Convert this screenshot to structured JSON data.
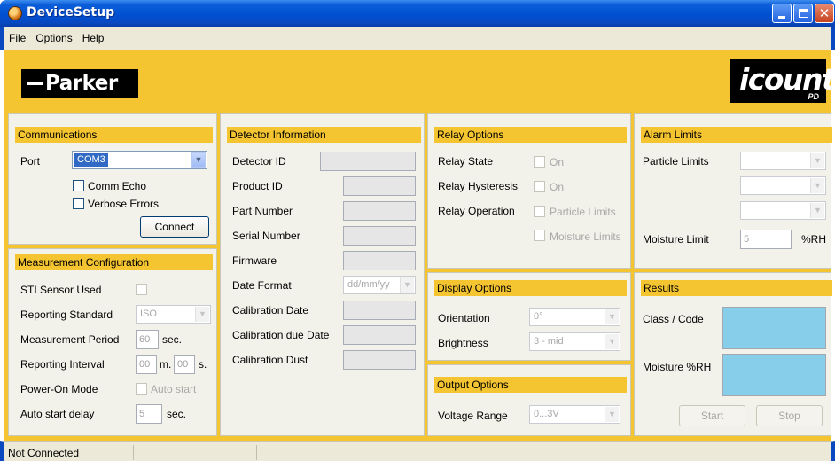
{
  "window": {
    "title": "DeviceSetup"
  },
  "menu": [
    "File",
    "Options",
    "Help"
  ],
  "banner": {
    "left_logo": "Parker",
    "right_logo": "icount",
    "right_logo_sub": "PD"
  },
  "communications": {
    "header": "Communications",
    "port_label": "Port",
    "port_value": "COM3",
    "comm_echo_label": "Comm Echo",
    "comm_echo_checked": false,
    "verbose_errors_label": "Verbose Errors",
    "verbose_errors_checked": false,
    "connect_label": "Connect"
  },
  "measurement": {
    "header": "Measurement Configuration",
    "sti_sensor_label": "STI Sensor Used",
    "sti_sensor_checked": false,
    "reporting_standard_label": "Reporting Standard",
    "reporting_standard_value": "ISO",
    "measurement_period_label": "Measurement Period",
    "measurement_period_value": "60",
    "measurement_period_unit": "sec.",
    "reporting_interval_label": "Reporting Interval",
    "reporting_interval_min": "00",
    "reporting_interval_min_unit": "m.",
    "reporting_interval_sec": "00",
    "reporting_interval_sec_unit": "s.",
    "power_on_mode_label": "Power-On Mode",
    "auto_start_label": "Auto start",
    "auto_start_checked": false,
    "auto_start_delay_label": "Auto start delay",
    "auto_start_delay_value": "5",
    "auto_start_delay_unit": "sec."
  },
  "detector": {
    "header": "Detector Information",
    "detector_id_label": "Detector ID",
    "product_id_label": "Product ID",
    "part_number_label": "Part Number",
    "serial_number_label": "Serial Number",
    "firmware_label": "Firmware",
    "date_format_label": "Date Format",
    "date_format_value": "dd/mm/yy",
    "calibration_date_label": "Calibration Date",
    "calibration_due_date_label": "Calibration due Date",
    "calibration_dust_label": "Calibration Dust"
  },
  "relay": {
    "header": "Relay Options",
    "relay_state_label": "Relay State",
    "relay_state_option": "On",
    "relay_hysteresis_label": "Relay Hysteresis",
    "relay_hysteresis_option": "On",
    "relay_operation_label": "Relay Operation",
    "particle_limits_option": "Particle Limits",
    "moisture_limits_option": "Moisture Limits"
  },
  "display": {
    "header": "Display Options",
    "orientation_label": "Orientation",
    "orientation_value": "0°",
    "brightness_label": "Brightness",
    "brightness_value": "3 - mid"
  },
  "output": {
    "header": "Output Options",
    "voltage_range_label": "Voltage Range",
    "voltage_range_value": "0...3V"
  },
  "alarm": {
    "header": "Alarm Limits",
    "particle_limits_label": "Particle Limits",
    "moisture_limit_label": "Moisture Limit",
    "moisture_limit_value": "5",
    "moisture_limit_unit": "%RH"
  },
  "results": {
    "header": "Results",
    "class_code_label": "Class / Code",
    "moisture_rh_label": "Moisture %RH",
    "start_label": "Start",
    "stop_label": "Stop"
  },
  "status": {
    "text": "Not Connected"
  },
  "colors": {
    "accent_yellow": "#f4c431",
    "result_blue": "#87ceeb",
    "titlebar_blue": "#0050d2"
  }
}
